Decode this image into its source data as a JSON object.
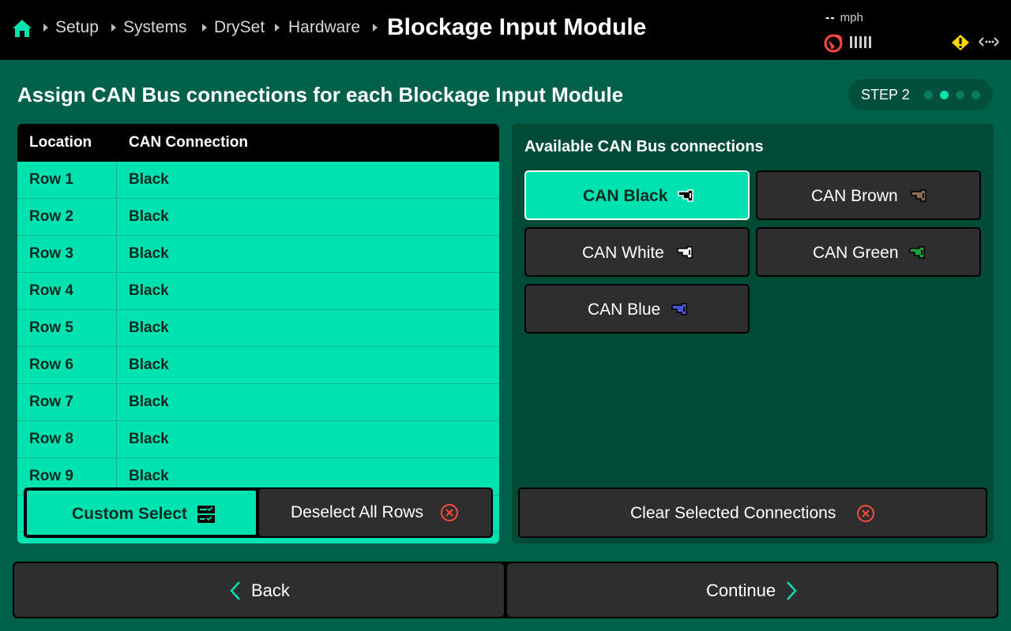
{
  "header": {
    "breadcrumb": [
      "Setup",
      "Systems",
      "DrySet",
      "Hardware"
    ],
    "title": "Blockage Input Module",
    "speed_value": "--",
    "speed_unit": "mph"
  },
  "heading": "Assign CAN Bus connections for each Blockage Input Module",
  "step": {
    "label": "STEP 2",
    "current": 2,
    "total": 4
  },
  "table": {
    "columns": [
      "Location",
      "CAN Connection"
    ],
    "rows": [
      {
        "location": "Row 1",
        "connection": "Black"
      },
      {
        "location": "Row 2",
        "connection": "Black"
      },
      {
        "location": "Row 3",
        "connection": "Black"
      },
      {
        "location": "Row 4",
        "connection": "Black"
      },
      {
        "location": "Row 5",
        "connection": "Black"
      },
      {
        "location": "Row 6",
        "connection": "Black"
      },
      {
        "location": "Row 7",
        "connection": "Black"
      },
      {
        "location": "Row 8",
        "connection": "Black"
      },
      {
        "location": "Row 9",
        "connection": "Black"
      }
    ]
  },
  "left_buttons": {
    "custom_select": "Custom Select",
    "deselect_all": "Deselect All Rows"
  },
  "right_panel": {
    "title": "Available CAN Bus connections",
    "connections": [
      {
        "label": "CAN Black",
        "color": "#000000",
        "selected": true
      },
      {
        "label": "CAN Brown",
        "color": "#8a6a58",
        "selected": false
      },
      {
        "label": "CAN White",
        "color": "#ffffff",
        "selected": false
      },
      {
        "label": "CAN Green",
        "color": "#1fa33a",
        "selected": false
      },
      {
        "label": "CAN Blue",
        "color": "#4a55d8",
        "selected": false
      }
    ],
    "clear_label": "Clear Selected Connections"
  },
  "nav": {
    "back": "Back",
    "continue": "Continue"
  },
  "colors": {
    "accent": "#00e2b0",
    "background": "#00614a",
    "warning": "#ffd600",
    "alert": "#ff4a3d"
  }
}
